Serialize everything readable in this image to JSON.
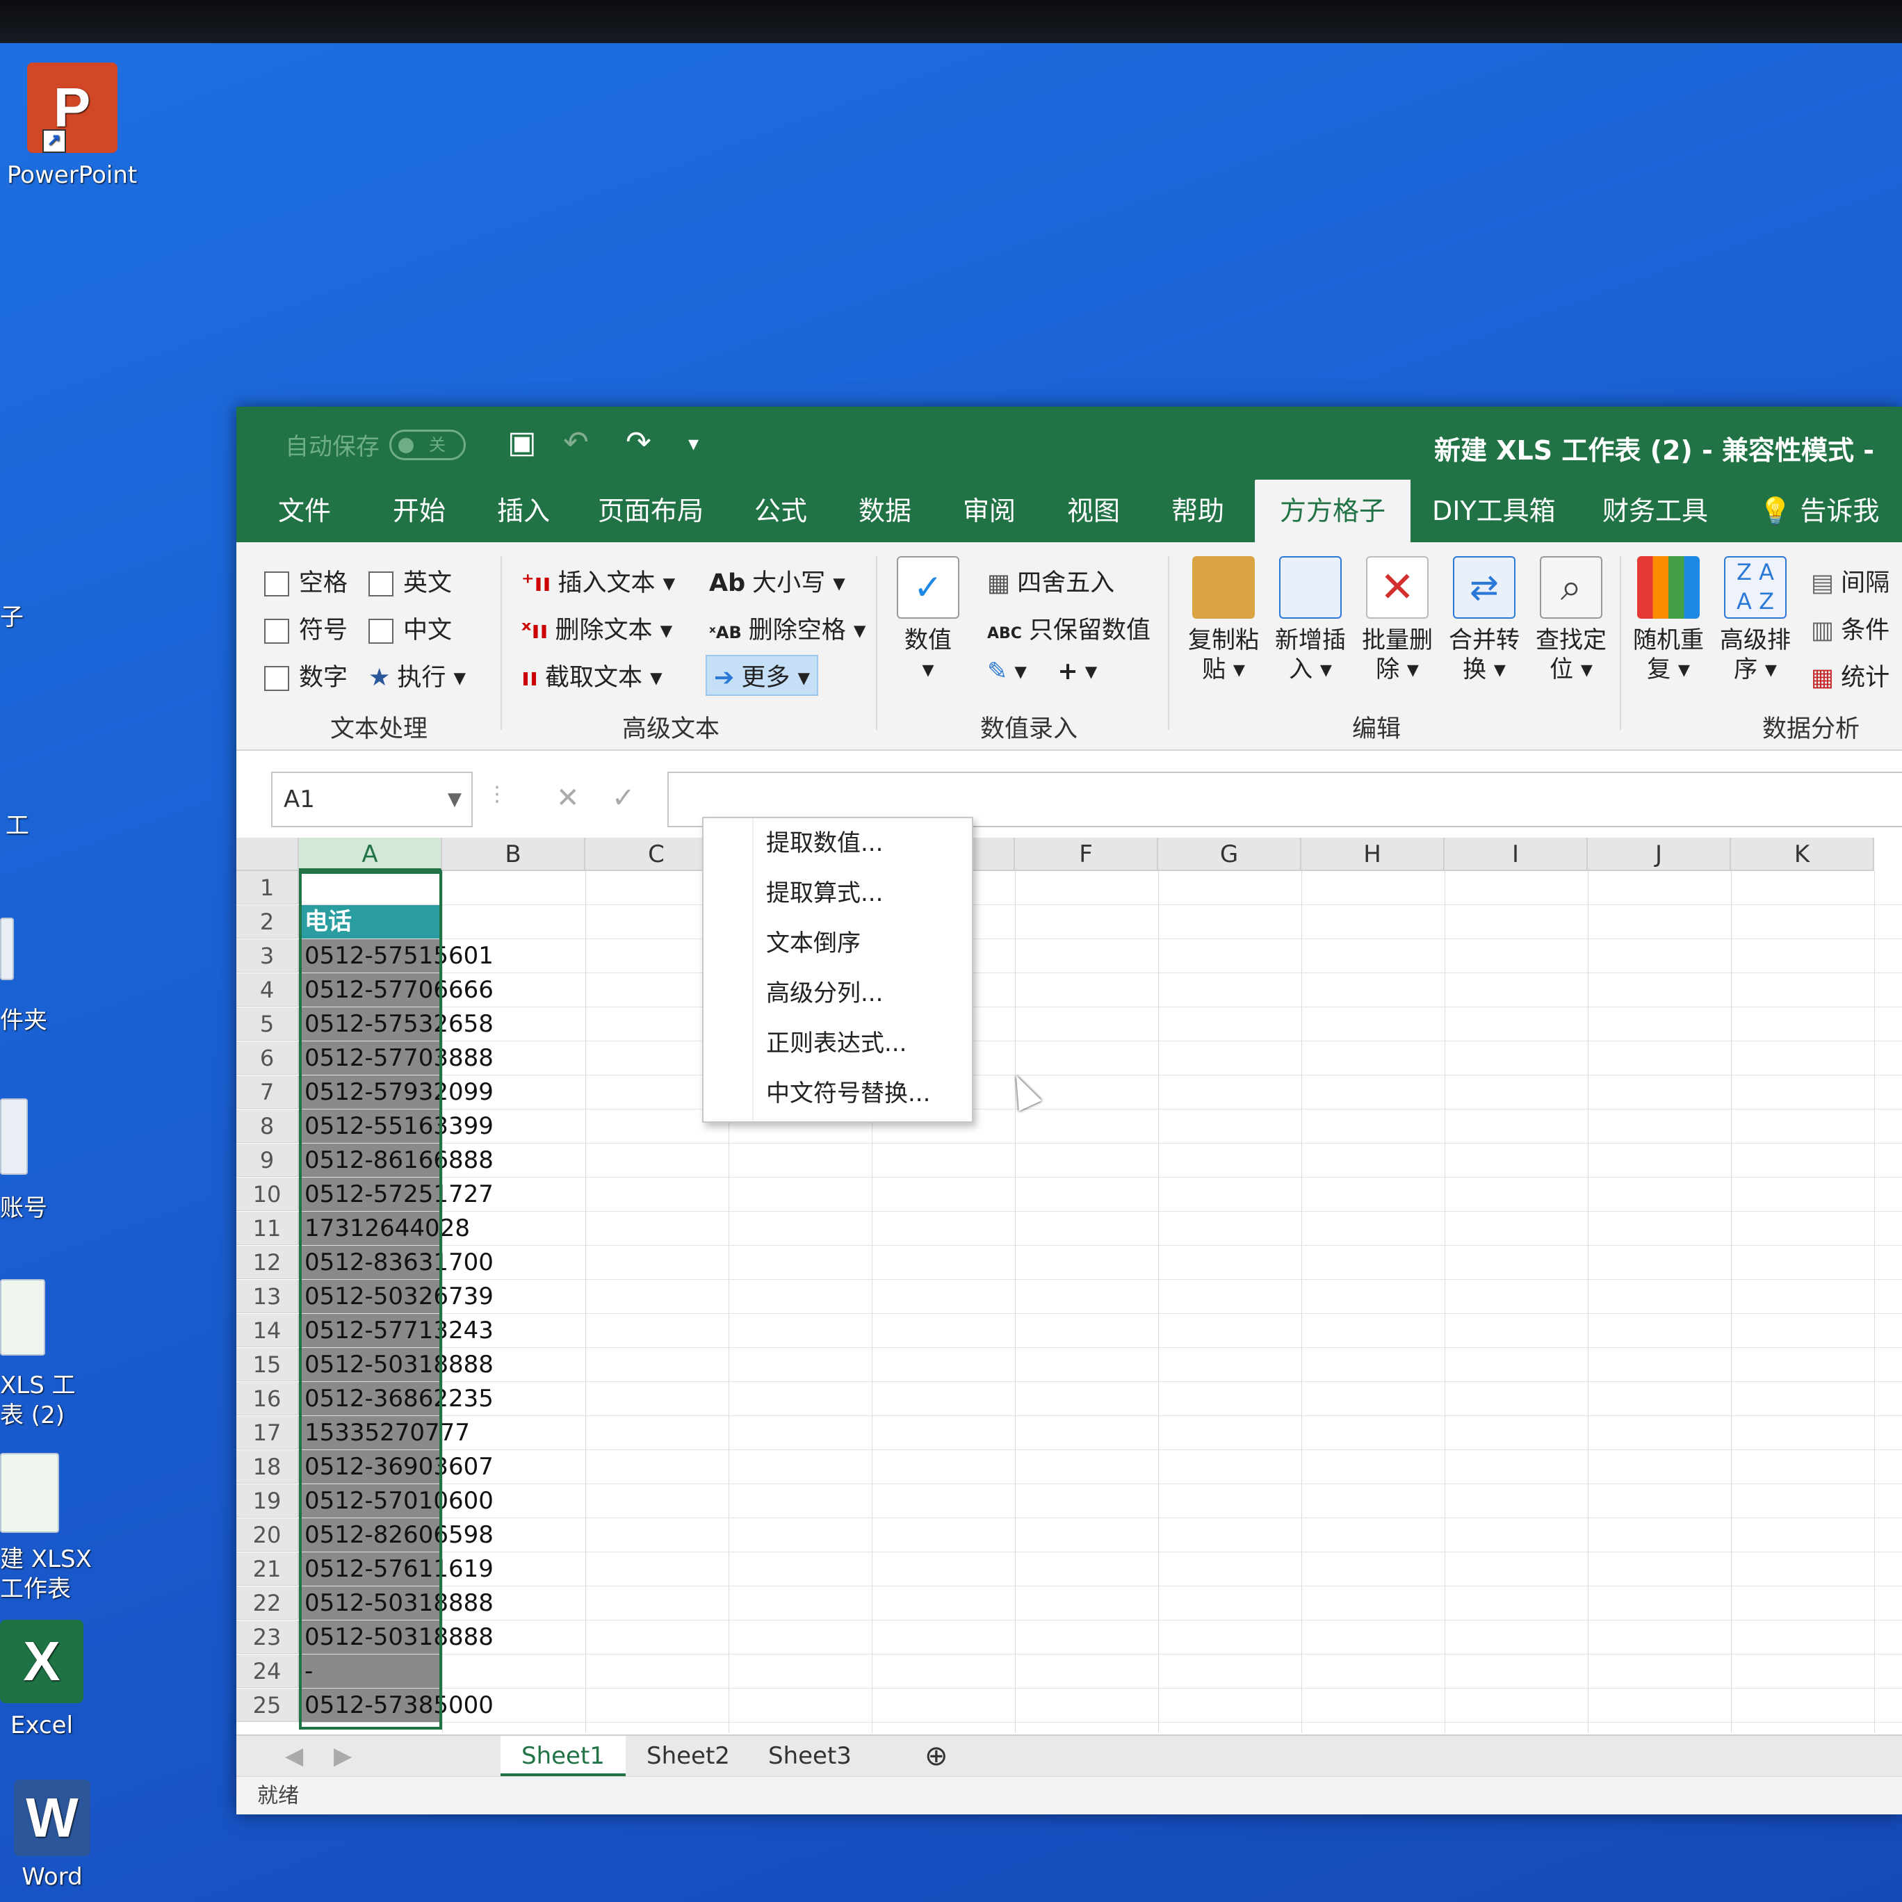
{
  "desktop": {
    "icons": [
      {
        "label": "PowerPoint",
        "letter": "P"
      },
      {
        "label": "Excel",
        "letter": "X"
      },
      {
        "label": "Word",
        "letter": "W"
      }
    ],
    "partial_labels": [
      "子",
      "工",
      "件夹",
      "账号",
      "XLS 工",
      "表 (2)",
      "建 XLSX",
      "工作表"
    ]
  },
  "window": {
    "autosave_label": "自动保存",
    "autosave_state": "关",
    "title": "新建 XLS 工作表 (2)  -  兼容性模式  -",
    "tabs": [
      "文件",
      "开始",
      "插入",
      "页面布局",
      "公式",
      "数据",
      "审阅",
      "视图",
      "帮助",
      "方方格子",
      "DIY工具箱",
      "财务工具",
      "告诉我你"
    ],
    "active_tab": "方方格子"
  },
  "ribbon": {
    "text_group": {
      "checkboxes": [
        "空格",
        "英文",
        "符号",
        "中文",
        "数字"
      ],
      "execute": "执行",
      "label": "文本处理"
    },
    "advanced_group": {
      "insert_text": "插入文本",
      "delete_text": "删除文本",
      "cut_text": "截取文本",
      "case": "大小写",
      "delete_space": "删除空格",
      "more": "更多",
      "label": "高级文本"
    },
    "number_group": {
      "value_btn": "数值",
      "round": "四舍五入",
      "keep_value": "只保留数值",
      "label": "数值录入"
    },
    "edit_group": {
      "buttons": [
        "复制粘贴",
        "新增插入",
        "批量删除",
        "合并转换",
        "查找定位"
      ],
      "label": "编辑"
    },
    "analysis_group": {
      "buttons": [
        "随机重复",
        "高级排序"
      ],
      "side": [
        "间隔",
        "条件",
        "统计"
      ],
      "label": "数据分析"
    }
  },
  "formula_bar": {
    "name_box": "A1",
    "cancel": "✕",
    "confirm": "✓"
  },
  "dropdown": {
    "items": [
      "提取数值...",
      "提取算式...",
      "文本倒序",
      "高级分列...",
      "正则表达式...",
      "中文符号替换..."
    ]
  },
  "grid": {
    "columns": [
      "A",
      "B",
      "C",
      "D",
      "E",
      "F",
      "G",
      "H",
      "I",
      "J",
      "K"
    ],
    "rows": [
      "1",
      "2",
      "3",
      "4",
      "5",
      "6",
      "7",
      "8",
      "9",
      "10",
      "11",
      "12",
      "13",
      "14",
      "15",
      "16",
      "17",
      "18",
      "19",
      "20",
      "21",
      "22",
      "23",
      "24",
      "25"
    ],
    "colA": [
      "",
      "电话",
      "0512-57515601",
      "0512-57706666",
      "0512-57532658",
      "0512-57703888",
      "0512-57932099",
      "0512-55163399",
      "0512-86166888",
      "0512-57251727",
      "17312644028",
      "0512-83631700",
      "0512-50326739",
      "0512-57713243",
      "0512-50318888",
      "0512-36862235",
      "15335270777",
      "0512-36903607",
      "0512-57010600",
      "0512-82606598",
      "0512-57611619",
      "0512-50318888",
      "0512-50318888",
      "-",
      "0512-57385000"
    ]
  },
  "sheets": [
    "Sheet1",
    "Sheet2",
    "Sheet3"
  ],
  "active_sheet": "Sheet1",
  "status": "就绪"
}
